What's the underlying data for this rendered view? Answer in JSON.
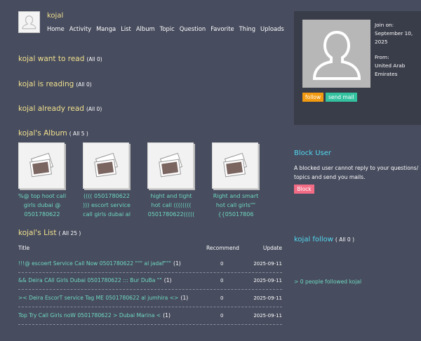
{
  "header": {
    "username": "kojal",
    "nav": [
      "Home",
      "Activity",
      "Manga",
      "List",
      "Album",
      "Topic",
      "Question",
      "Favorite",
      "Thing",
      "Uploads"
    ]
  },
  "sections": {
    "want_to_read": {
      "title": "kojal want to read",
      "count": "(All 0)"
    },
    "is_reading": {
      "title": "kojal is reading",
      "count": "(All 0)"
    },
    "already_read": {
      "title": "kojal already read",
      "count": "(All 0)"
    },
    "album": {
      "title": "kojal's Album",
      "count": "( All 5 )"
    },
    "list": {
      "title": "kojal's List",
      "count": "( All 25 )"
    }
  },
  "album": {
    "items": [
      "%@ top hoot call girls dubai @ 0501780622",
      "(((( 0501780622 ))) escort service call girls dubai al",
      "hight and tight hot call (((((((( 0501780622(((((",
      "Right and smart hot call girls\"\"{{05017806"
    ]
  },
  "list": {
    "headers": {
      "title": "Title",
      "recommend": "Recommend",
      "update": "Update"
    },
    "rows": [
      {
        "title": "!!!@ escoert Service Call Now 0501780622 \"\"\" al jadaf\"\"\"",
        "count": "(1)",
        "recommend": "0",
        "update": "2025-09-11"
      },
      {
        "title": "&& Deira CAll Girls Dubai 0501780622 ::: Bur DuBa \"\"",
        "count": "(1)",
        "recommend": "0",
        "update": "2025-09-11"
      },
      {
        "title": ">< Deira EscorT service Tag ME 0501780622 al jumhira <>",
        "count": "(1)",
        "recommend": "0",
        "update": "2025-09-11"
      },
      {
        "title": "Top Try Call Girls noW 0501780622 > Dubai Marina <",
        "count": "(1)",
        "recommend": "0",
        "update": "2025-09-11"
      }
    ]
  },
  "profile": {
    "join_label": "Join on:",
    "join_date": "September 10, 2025",
    "from_label": "From:",
    "from_value": "United Arab Emirates",
    "follow_label": "follow",
    "mail_label": "send mail"
  },
  "block": {
    "title": "Block User",
    "description": "A blocked user cannot reply to your questions/ topics and send you mails.",
    "button": "Block"
  },
  "follow": {
    "title": "kojal follow",
    "count": "( All 0 )",
    "followers": "> 0 people followed kojal"
  },
  "colors": {
    "background": "#474c5e",
    "heading": "#f1e08f",
    "link": "#6fd8c0",
    "accent_blue": "#53d9f3",
    "follow_btn": "#f29a11",
    "mail_btn": "#33c19f",
    "block_btn": "#f26c86"
  }
}
